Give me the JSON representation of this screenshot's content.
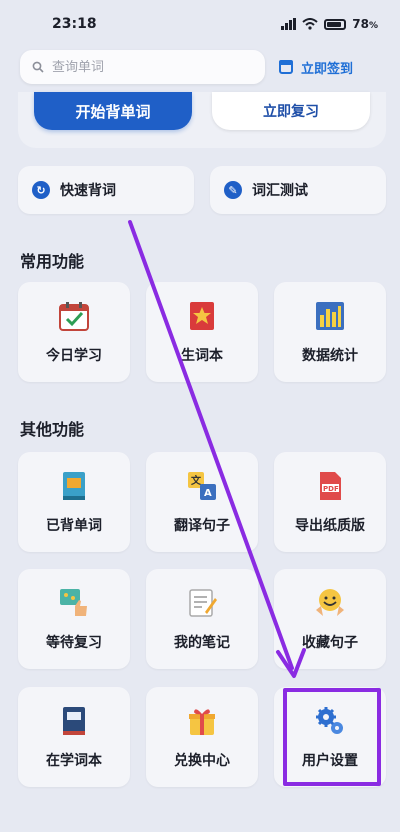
{
  "status": {
    "time": "23:18",
    "battery": "78",
    "battery_unit": "%"
  },
  "search": {
    "placeholder": "查询单词"
  },
  "signin": {
    "label": "立即签到"
  },
  "actions": {
    "start": "开始背单词",
    "review": "立即复习"
  },
  "quick": [
    {
      "label": "快速背词",
      "icon": "speed-icon"
    },
    {
      "label": "词汇测试",
      "icon": "wrench-icon"
    }
  ],
  "common": {
    "title": "常用功能",
    "items": [
      {
        "label": "今日学习",
        "icon": "calendar-check-icon"
      },
      {
        "label": "生词本",
        "icon": "bookmark-star-icon"
      },
      {
        "label": "数据统计",
        "icon": "bar-chart-icon"
      }
    ]
  },
  "other": {
    "title": "其他功能",
    "items": [
      {
        "label": "已背单词",
        "icon": "book-icon"
      },
      {
        "label": "翻译句子",
        "icon": "translate-icon"
      },
      {
        "label": "导出纸质版",
        "icon": "pdf-icon"
      },
      {
        "label": "等待复习",
        "icon": "thumbs-up-icon"
      },
      {
        "label": "我的笔记",
        "icon": "notepad-icon"
      },
      {
        "label": "收藏句子",
        "icon": "smile-icon"
      },
      {
        "label": "在学词本",
        "icon": "dictionary-icon"
      },
      {
        "label": "兑换中心",
        "icon": "gift-icon"
      },
      {
        "label": "用户设置",
        "icon": "gears-icon"
      }
    ]
  },
  "colors": {
    "accent": "#1f5fc7",
    "highlight": "#8a2be2"
  }
}
